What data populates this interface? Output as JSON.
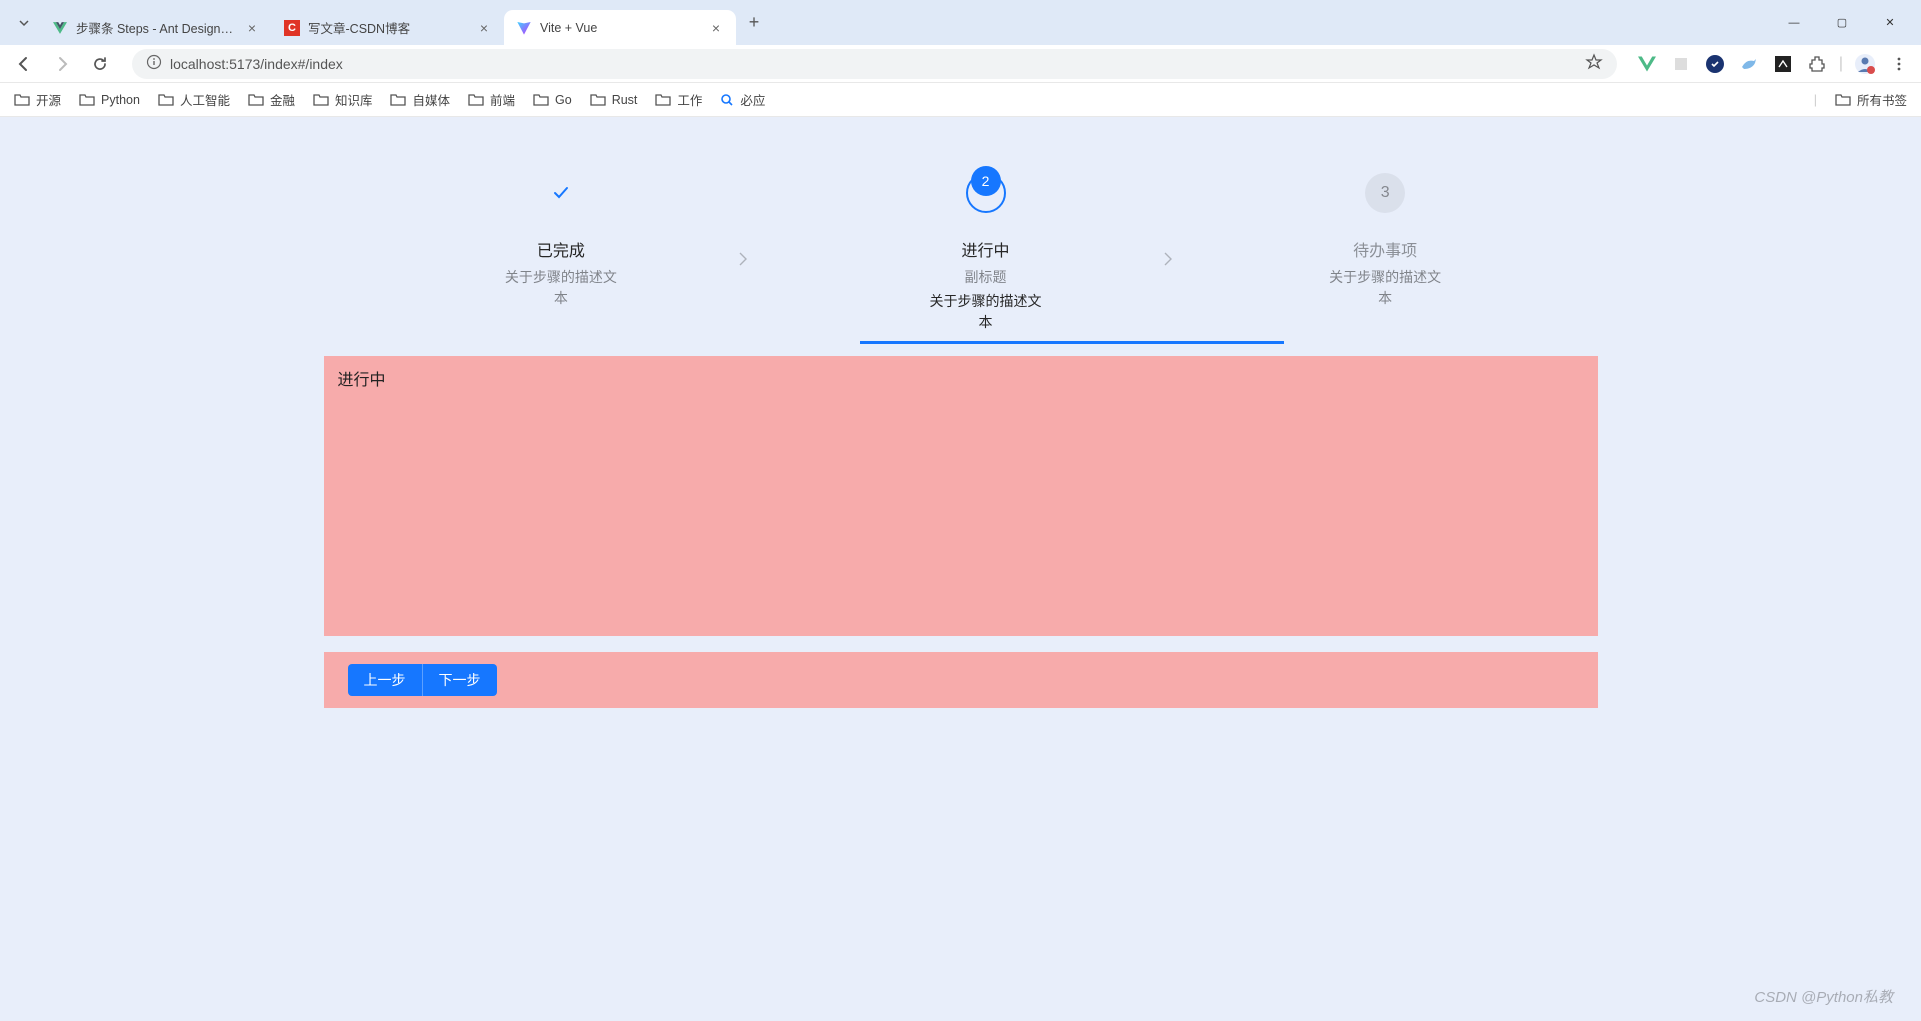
{
  "browser": {
    "tabs": [
      {
        "title": "步骤条 Steps - Ant Design Vu",
        "icon": "vue"
      },
      {
        "title": "写文章-CSDN博客",
        "icon": "csdn"
      },
      {
        "title": "Vite + Vue",
        "icon": "vite",
        "active": true
      }
    ],
    "url": "localhost:5173/index#/index",
    "bookmarks": [
      "开源",
      "Python",
      "人工智能",
      "金融",
      "知识库",
      "自媒体",
      "前端",
      "Go",
      "Rust",
      "工作"
    ],
    "bookmarks_search": "必应",
    "all_bookmarks": "所有书签"
  },
  "steps": [
    {
      "title": "已完成",
      "desc": "关于步骤的描述文本",
      "status": "done"
    },
    {
      "title": "进行中",
      "sub": "副标题",
      "desc": "关于步骤的描述文本",
      "status": "active",
      "number": "2"
    },
    {
      "title": "待办事项",
      "desc": "关于步骤的描述文本",
      "status": "wait",
      "number": "3"
    }
  ],
  "content": {
    "text": "进行中"
  },
  "actions": {
    "prev": "上一步",
    "next": "下一步"
  },
  "watermark": "CSDN @Python私教"
}
